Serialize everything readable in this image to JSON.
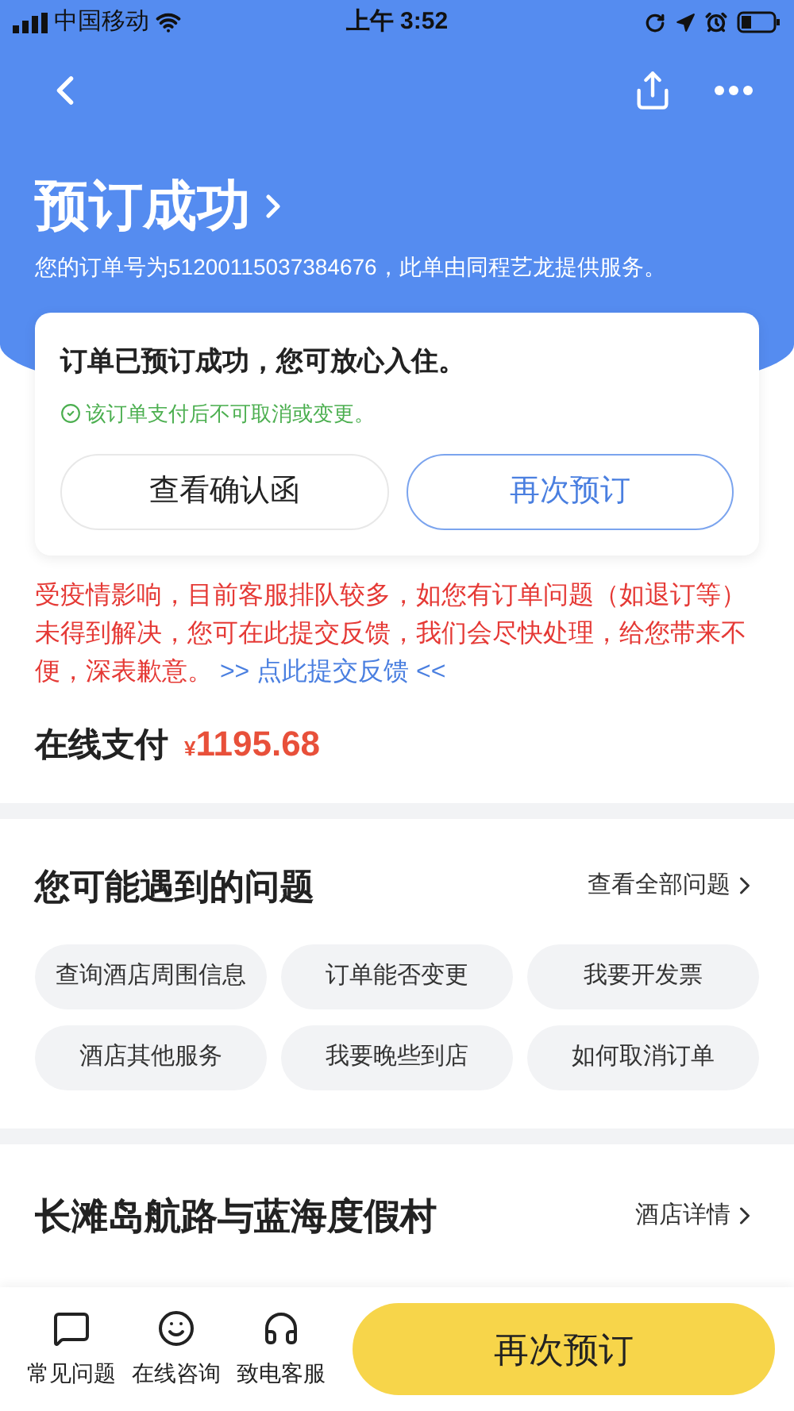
{
  "status_bar": {
    "carrier": "中国移动",
    "time": "上午 3:52"
  },
  "header": {
    "title": "预订成功",
    "order_note": "您的订单号为51200115037384676，此单由同程艺龙提供服务。"
  },
  "card": {
    "message": "订单已预订成功，您可放心入住。",
    "notice": "该订单支付后不可取消或变更。",
    "buttons": [
      {
        "label": "查看确认函",
        "kind": "plain"
      },
      {
        "label": "再次预订",
        "kind": "outline"
      }
    ]
  },
  "alert": {
    "text": "受疫情影响，目前客服排队较多，如您有订单问题（如退订等）未得到解决，您可在此提交反馈，我们会尽快处理，给您带来不便，深表歉意。",
    "link": ">> 点此提交反馈 <<"
  },
  "payment": {
    "label": "在线支付",
    "currency": "¥",
    "amount": "1195.68"
  },
  "faq": {
    "title": "您可能遇到的问题",
    "more": "查看全部问题",
    "chips": [
      "查询酒店周围信息",
      "订单能否变更",
      "我要开发票",
      "酒店其他服务",
      "我要晚些到店",
      "如何取消订单"
    ]
  },
  "hotel": {
    "name": "长滩岛航路与蓝海度假村",
    "details": "酒店详情"
  },
  "bottom_bar": {
    "items": [
      {
        "label": "常见问题",
        "kind": "faq"
      },
      {
        "label": "在线咨询",
        "kind": "chat"
      },
      {
        "label": "致电客服",
        "kind": "phone"
      }
    ],
    "cta": "再次预订"
  }
}
